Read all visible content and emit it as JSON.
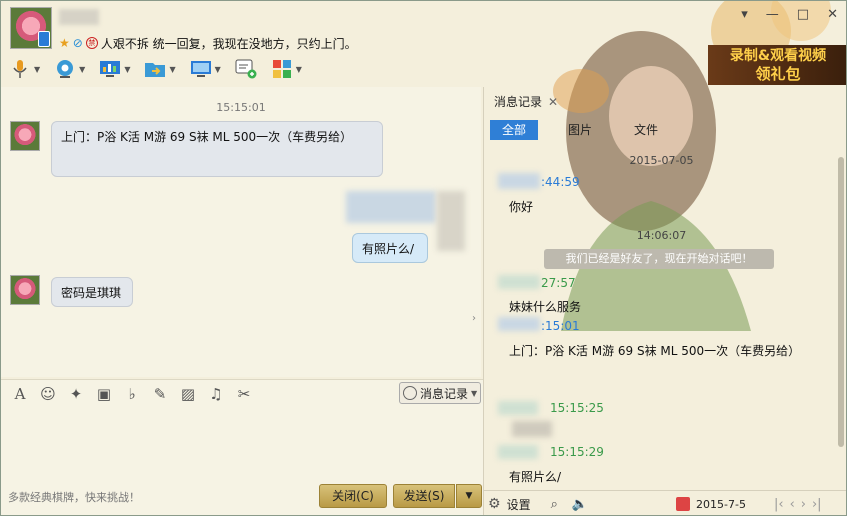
{
  "title": {
    "signature": "人艰不拆 统一回复，我现在没地方，只约上门。"
  },
  "window_controls": [
    "▾",
    "—",
    "□",
    "✕"
  ],
  "toolbar_icons": [
    "microphone-icon",
    "video-icon",
    "screen-share-icon",
    "file-transfer-icon",
    "remote-desktop-icon",
    "screenshot-icon",
    "app-grid-icon"
  ],
  "promo": {
    "line1": "录制&观看视频",
    "line2": "领礼包"
  },
  "chat": {
    "timestamp": "15:15:01",
    "messages": [
      {
        "side": "left",
        "text": "上门：P浴 K活 M游 69 S袜 ML 500一次（车费另给）"
      },
      {
        "side": "right",
        "text": "有照片么/"
      },
      {
        "side": "left",
        "text": "密码是琪琪"
      }
    ]
  },
  "input_toolbar": {
    "history_label": "消息记录"
  },
  "bottom": {
    "promo_text": "多款经典棋牌，快来挑战！",
    "close_label": "关闭(C)",
    "send_label": "发送(S)"
  },
  "history": {
    "title": "消息记录",
    "tabs": [
      "全部",
      "图片",
      "文件"
    ],
    "date": "2015-07-05",
    "entries": [
      {
        "time": ":44:59",
        "text": "你好"
      },
      {
        "time": "14:06:07",
        "system": "我们已经是好友了，现在开始对话吧！"
      },
      {
        "time": "27:57",
        "text": "妹妹什么服务"
      },
      {
        "time": ":15:01",
        "text": "上门：P浴 K活 M游 69 S袜 ML 500一次（车费另给）"
      },
      {
        "time": "15:15:25",
        "text": ""
      },
      {
        "time": "15:15:29",
        "text": "有照片么/"
      }
    ],
    "footer": {
      "settings": "设置",
      "date": "2015-7-5"
    }
  },
  "colors": {
    "accent": "#2f7fd6",
    "name_green": "#3a9a4a",
    "button_gold": "#c9b060"
  }
}
